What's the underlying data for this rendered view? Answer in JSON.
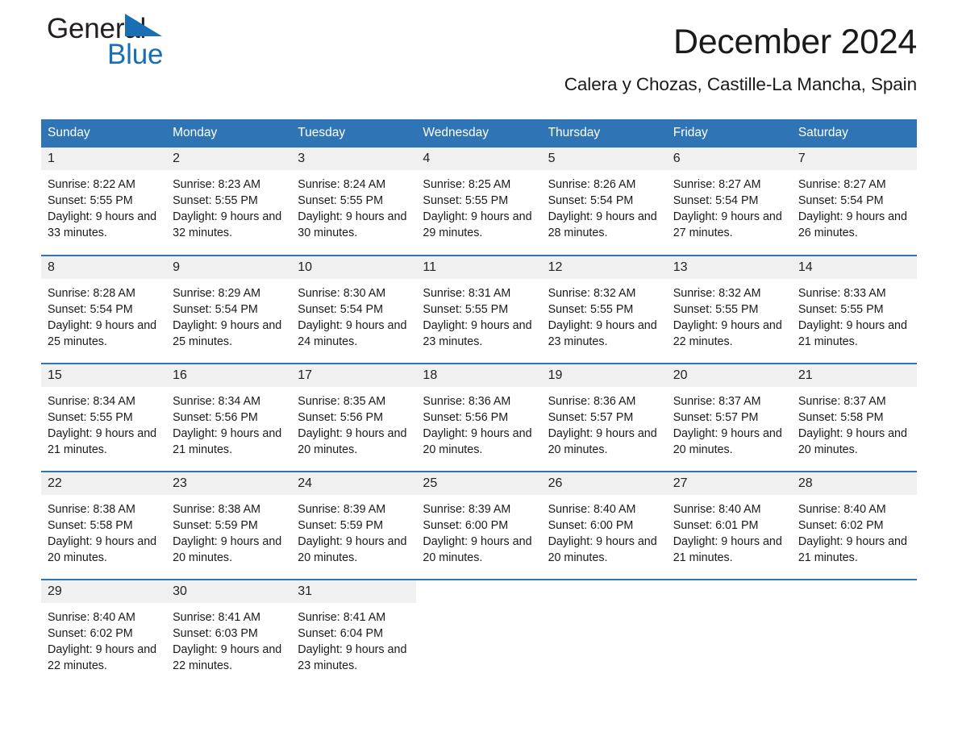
{
  "brand": {
    "name_part1": "General",
    "name_part2": "Blue",
    "accent_color": "#1a6fb4",
    "logo_icon": "triangle-flag-icon"
  },
  "header": {
    "title": "December 2024",
    "location": "Calera y Chozas, Castille-La Mancha, Spain"
  },
  "calendar": {
    "header_bg": "#2f75b5",
    "daynum_bg": "#f0f0f0",
    "weekday_headers": [
      "Sunday",
      "Monday",
      "Tuesday",
      "Wednesday",
      "Thursday",
      "Friday",
      "Saturday"
    ],
    "weeks": [
      [
        {
          "day": "1",
          "info": "Sunrise: 8:22 AM\nSunset: 5:55 PM\nDaylight: 9 hours and 33 minutes."
        },
        {
          "day": "2",
          "info": "Sunrise: 8:23 AM\nSunset: 5:55 PM\nDaylight: 9 hours and 32 minutes."
        },
        {
          "day": "3",
          "info": "Sunrise: 8:24 AM\nSunset: 5:55 PM\nDaylight: 9 hours and 30 minutes."
        },
        {
          "day": "4",
          "info": "Sunrise: 8:25 AM\nSunset: 5:55 PM\nDaylight: 9 hours and 29 minutes."
        },
        {
          "day": "5",
          "info": "Sunrise: 8:26 AM\nSunset: 5:54 PM\nDaylight: 9 hours and 28 minutes."
        },
        {
          "day": "6",
          "info": "Sunrise: 8:27 AM\nSunset: 5:54 PM\nDaylight: 9 hours and 27 minutes."
        },
        {
          "day": "7",
          "info": "Sunrise: 8:27 AM\nSunset: 5:54 PM\nDaylight: 9 hours and 26 minutes."
        }
      ],
      [
        {
          "day": "8",
          "info": "Sunrise: 8:28 AM\nSunset: 5:54 PM\nDaylight: 9 hours and 25 minutes."
        },
        {
          "day": "9",
          "info": "Sunrise: 8:29 AM\nSunset: 5:54 PM\nDaylight: 9 hours and 25 minutes."
        },
        {
          "day": "10",
          "info": "Sunrise: 8:30 AM\nSunset: 5:54 PM\nDaylight: 9 hours and 24 minutes."
        },
        {
          "day": "11",
          "info": "Sunrise: 8:31 AM\nSunset: 5:55 PM\nDaylight: 9 hours and 23 minutes."
        },
        {
          "day": "12",
          "info": "Sunrise: 8:32 AM\nSunset: 5:55 PM\nDaylight: 9 hours and 23 minutes."
        },
        {
          "day": "13",
          "info": "Sunrise: 8:32 AM\nSunset: 5:55 PM\nDaylight: 9 hours and 22 minutes."
        },
        {
          "day": "14",
          "info": "Sunrise: 8:33 AM\nSunset: 5:55 PM\nDaylight: 9 hours and 21 minutes."
        }
      ],
      [
        {
          "day": "15",
          "info": "Sunrise: 8:34 AM\nSunset: 5:55 PM\nDaylight: 9 hours and 21 minutes."
        },
        {
          "day": "16",
          "info": "Sunrise: 8:34 AM\nSunset: 5:56 PM\nDaylight: 9 hours and 21 minutes."
        },
        {
          "day": "17",
          "info": "Sunrise: 8:35 AM\nSunset: 5:56 PM\nDaylight: 9 hours and 20 minutes."
        },
        {
          "day": "18",
          "info": "Sunrise: 8:36 AM\nSunset: 5:56 PM\nDaylight: 9 hours and 20 minutes."
        },
        {
          "day": "19",
          "info": "Sunrise: 8:36 AM\nSunset: 5:57 PM\nDaylight: 9 hours and 20 minutes."
        },
        {
          "day": "20",
          "info": "Sunrise: 8:37 AM\nSunset: 5:57 PM\nDaylight: 9 hours and 20 minutes."
        },
        {
          "day": "21",
          "info": "Sunrise: 8:37 AM\nSunset: 5:58 PM\nDaylight: 9 hours and 20 minutes."
        }
      ],
      [
        {
          "day": "22",
          "info": "Sunrise: 8:38 AM\nSunset: 5:58 PM\nDaylight: 9 hours and 20 minutes."
        },
        {
          "day": "23",
          "info": "Sunrise: 8:38 AM\nSunset: 5:59 PM\nDaylight: 9 hours and 20 minutes."
        },
        {
          "day": "24",
          "info": "Sunrise: 8:39 AM\nSunset: 5:59 PM\nDaylight: 9 hours and 20 minutes."
        },
        {
          "day": "25",
          "info": "Sunrise: 8:39 AM\nSunset: 6:00 PM\nDaylight: 9 hours and 20 minutes."
        },
        {
          "day": "26",
          "info": "Sunrise: 8:40 AM\nSunset: 6:00 PM\nDaylight: 9 hours and 20 minutes."
        },
        {
          "day": "27",
          "info": "Sunrise: 8:40 AM\nSunset: 6:01 PM\nDaylight: 9 hours and 21 minutes."
        },
        {
          "day": "28",
          "info": "Sunrise: 8:40 AM\nSunset: 6:02 PM\nDaylight: 9 hours and 21 minutes."
        }
      ],
      [
        {
          "day": "29",
          "info": "Sunrise: 8:40 AM\nSunset: 6:02 PM\nDaylight: 9 hours and 22 minutes."
        },
        {
          "day": "30",
          "info": "Sunrise: 8:41 AM\nSunset: 6:03 PM\nDaylight: 9 hours and 22 minutes."
        },
        {
          "day": "31",
          "info": "Sunrise: 8:41 AM\nSunset: 6:04 PM\nDaylight: 9 hours and 23 minutes."
        },
        {
          "day": "",
          "info": ""
        },
        {
          "day": "",
          "info": ""
        },
        {
          "day": "",
          "info": ""
        },
        {
          "day": "",
          "info": ""
        }
      ]
    ]
  }
}
